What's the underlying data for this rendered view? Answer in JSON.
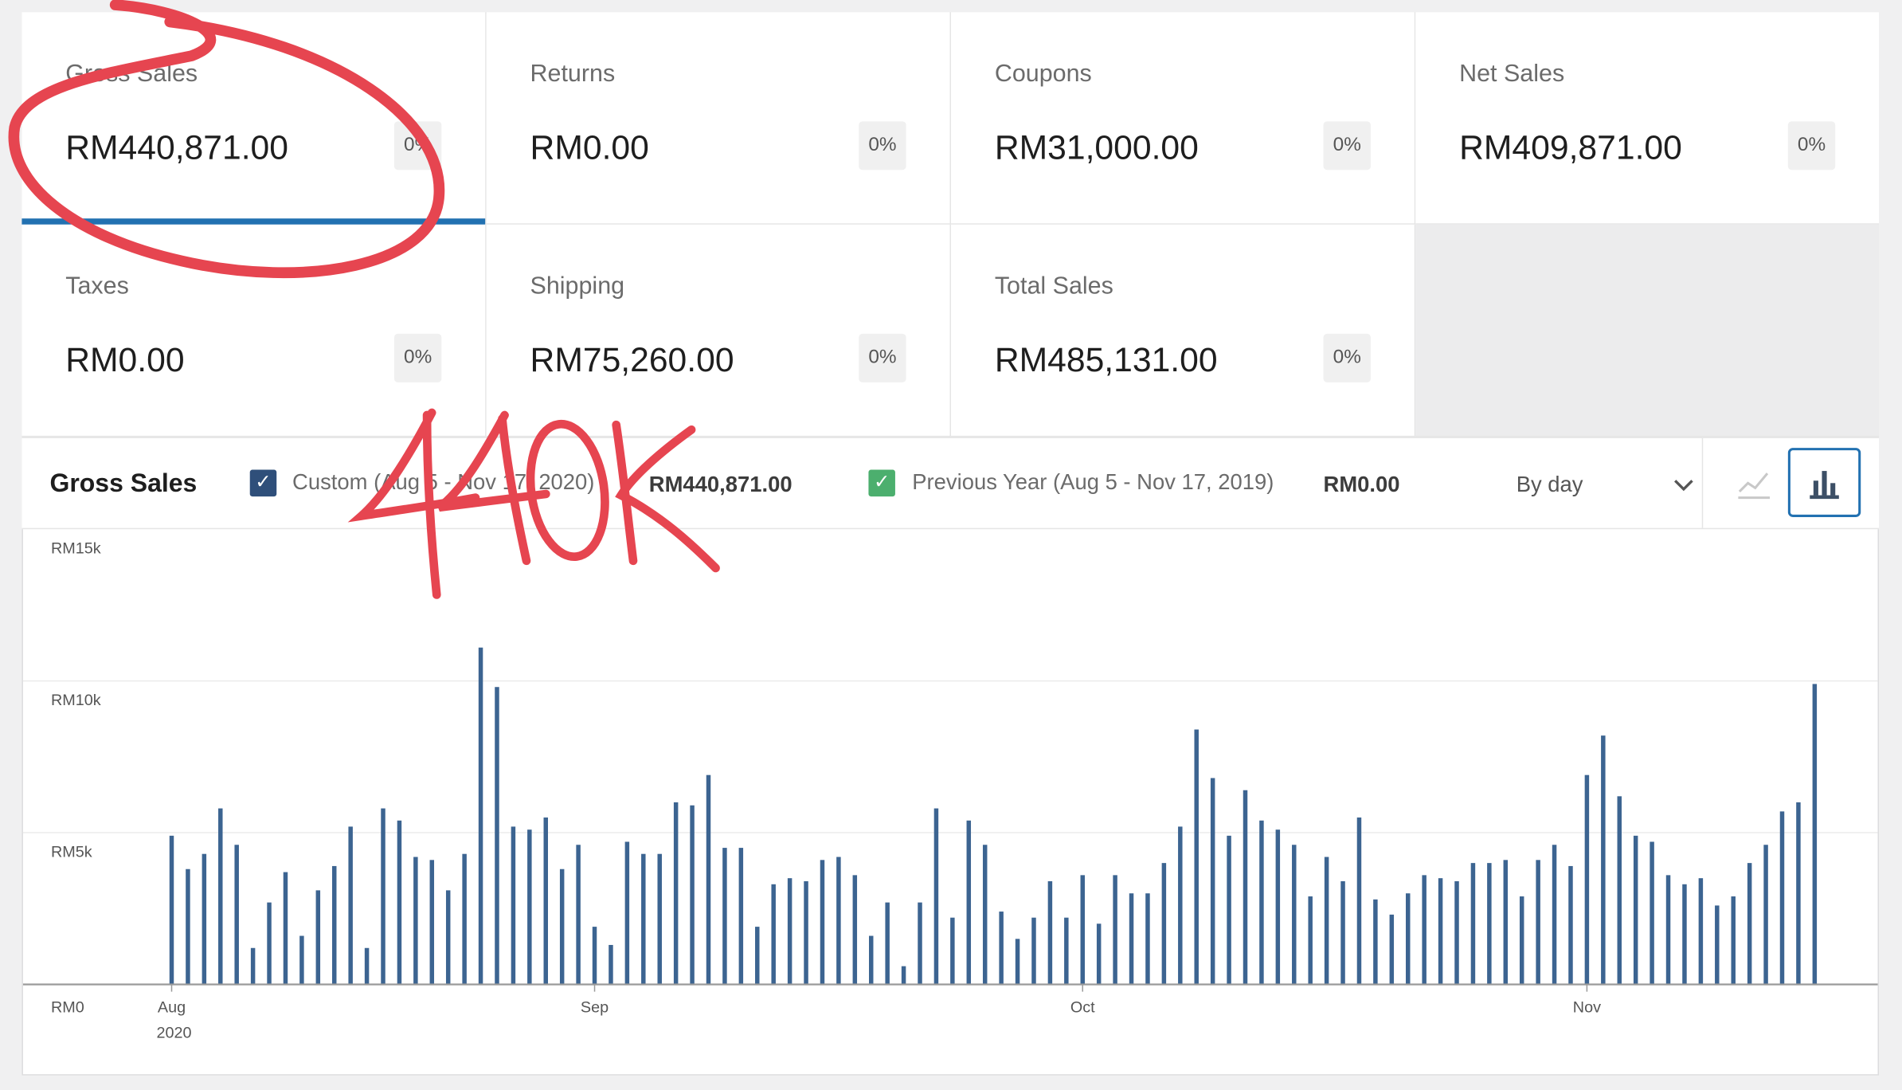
{
  "summary": {
    "tiles": [
      {
        "label": "Gross Sales",
        "value": "RM440,871.00",
        "delta": "0%"
      },
      {
        "label": "Returns",
        "value": "RM0.00",
        "delta": "0%"
      },
      {
        "label": "Coupons",
        "value": "RM31,000.00",
        "delta": "0%"
      },
      {
        "label": "Net Sales",
        "value": "RM409,871.00",
        "delta": "0%"
      },
      {
        "label": "Taxes",
        "value": "RM0.00",
        "delta": "0%"
      },
      {
        "label": "Shipping",
        "value": "RM75,260.00",
        "delta": "0%"
      },
      {
        "label": "Total Sales",
        "value": "RM485,131.00",
        "delta": "0%"
      }
    ]
  },
  "chart_header": {
    "title": "Gross Sales",
    "primary_legend": "Custom (Aug 5 - Nov 17, 2020)",
    "primary_total": "RM440,871.00",
    "secondary_legend": "Previous Year (Aug 5 - Nov 17, 2019)",
    "secondary_total": "RM0.00",
    "interval": "By day",
    "colors": {
      "primary_check": "#2f4f7a",
      "secondary_check": "#4caf6e",
      "bar": "#3c6491",
      "selected_tab": "#2271b1"
    },
    "icons": [
      "line-chart-icon",
      "bar-chart-icon"
    ]
  },
  "annotation": {
    "handwritten_text": "440K",
    "color": "#e64550"
  },
  "chart_data": {
    "type": "bar",
    "title": "",
    "xlabel": "",
    "ylabel": "",
    "ylim": [
      0,
      15000
    ],
    "grid": true,
    "y_ticks": [
      {
        "value": 0,
        "label": "RM0"
      },
      {
        "value": 5000,
        "label": "RM5k"
      },
      {
        "value": 10000,
        "label": "RM10k"
      },
      {
        "value": 15000,
        "label": "RM15k"
      }
    ],
    "x_ticks": [
      {
        "index": 0,
        "label": "Aug",
        "sublabel": "2020"
      },
      {
        "index": 26,
        "label": "Sep",
        "sublabel": ""
      },
      {
        "index": 56,
        "label": "Oct",
        "sublabel": ""
      },
      {
        "index": 87,
        "label": "Nov",
        "sublabel": ""
      }
    ],
    "series": [
      {
        "values": [
          4900,
          3800,
          4300,
          5800,
          4600,
          1200,
          2700,
          3700,
          1600,
          3100,
          3900,
          5200,
          1200,
          5800,
          5400,
          4200,
          4100,
          3100,
          4300,
          11100,
          9800,
          5200,
          5100,
          5500,
          3800,
          4600,
          1900,
          1300,
          4700,
          4300,
          4300,
          6000,
          5900,
          6900,
          4500,
          4500,
          1900,
          3300,
          3500,
          3400,
          4100,
          4200,
          3600,
          1600,
          2700,
          600,
          2700,
          5800,
          2200,
          5400,
          4600,
          2400,
          1500,
          2200,
          3400,
          2200,
          3600,
          2000,
          3600,
          3000,
          3000,
          4000,
          5200,
          8400,
          6800,
          4900,
          6400,
          5400,
          5100,
          4600,
          2900,
          4200,
          3400,
          5500,
          2800,
          2300,
          3000,
          3600,
          3500,
          3400,
          4000,
          4000,
          4100,
          2900,
          4100,
          4600,
          3900,
          6900,
          8200,
          6200,
          4900,
          4700,
          3600,
          3300,
          3500,
          2600,
          2900,
          4000,
          4600,
          5700,
          6000,
          9900
        ]
      }
    ]
  }
}
